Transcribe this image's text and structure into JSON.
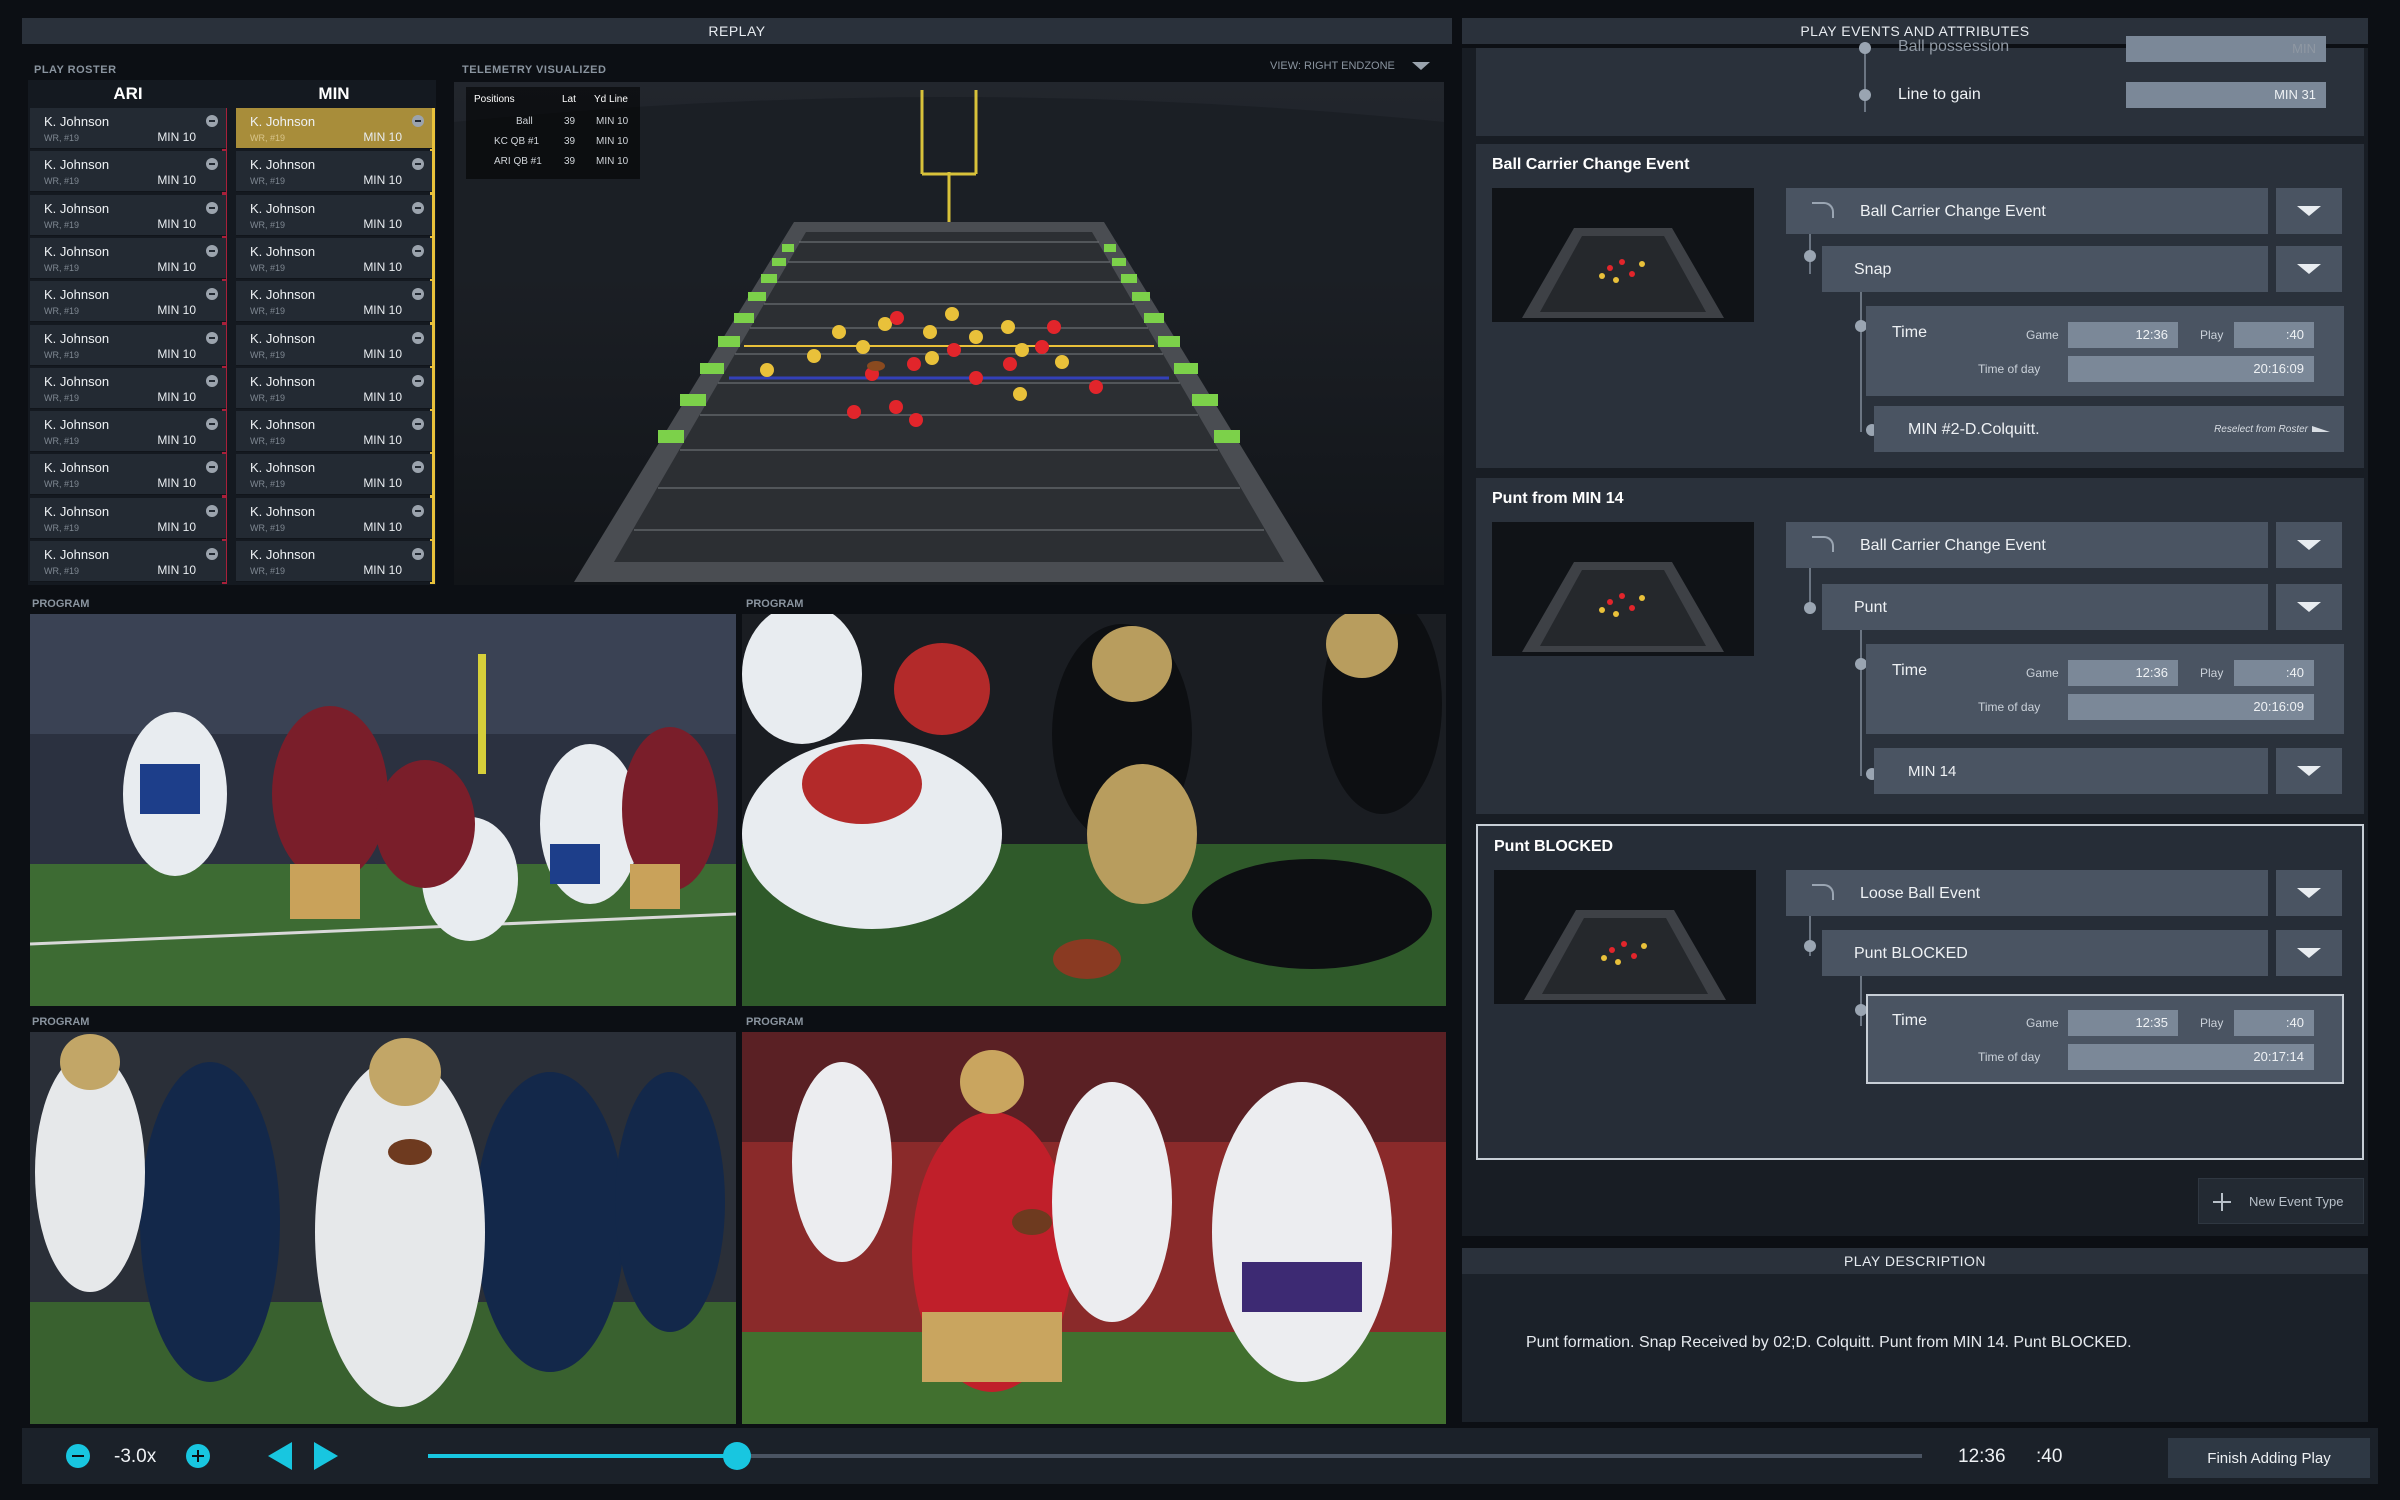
{
  "replay": {
    "title": "REPLAY",
    "roster_label": "PLAY ROSTER",
    "teams": [
      "ARI",
      "MIN"
    ],
    "ari_rows": [
      {
        "name": "K. Johnson",
        "pos": "WR, #19",
        "yd": "MIN 10"
      },
      {
        "name": "K. Johnson",
        "pos": "WR, #19",
        "yd": "MIN 10"
      },
      {
        "name": "K. Johnson",
        "pos": "WR, #19",
        "yd": "MIN 10"
      },
      {
        "name": "K. Johnson",
        "pos": "WR, #19",
        "yd": "MIN 10"
      },
      {
        "name": "K. Johnson",
        "pos": "WR, #19",
        "yd": "MIN 10"
      },
      {
        "name": "K. Johnson",
        "pos": "WR, #19",
        "yd": "MIN 10"
      },
      {
        "name": "K. Johnson",
        "pos": "WR, #19",
        "yd": "MIN 10"
      },
      {
        "name": "K. Johnson",
        "pos": "WR, #19",
        "yd": "MIN 10"
      },
      {
        "name": "K. Johnson",
        "pos": "WR, #19",
        "yd": "MIN 10"
      },
      {
        "name": "K. Johnson",
        "pos": "WR, #19",
        "yd": "MIN 10"
      },
      {
        "name": "K. Johnson",
        "pos": "WR, #19",
        "yd": "MIN 10"
      }
    ],
    "min_rows": [
      {
        "name": "K. Johnson",
        "pos": "WR, #19",
        "yd": "MIN 10"
      },
      {
        "name": "K. Johnson",
        "pos": "WR, #19",
        "yd": "MIN 10"
      },
      {
        "name": "K. Johnson",
        "pos": "WR, #19",
        "yd": "MIN 10"
      },
      {
        "name": "K. Johnson",
        "pos": "WR, #19",
        "yd": "MIN 10"
      },
      {
        "name": "K. Johnson",
        "pos": "WR, #19",
        "yd": "MIN 10"
      },
      {
        "name": "K. Johnson",
        "pos": "WR, #19",
        "yd": "MIN 10"
      },
      {
        "name": "K. Johnson",
        "pos": "WR, #19",
        "yd": "MIN 10"
      },
      {
        "name": "K. Johnson",
        "pos": "WR, #19",
        "yd": "MIN 10"
      },
      {
        "name": "K. Johnson",
        "pos": "WR, #19",
        "yd": "MIN 10"
      },
      {
        "name": "K. Johnson",
        "pos": "WR, #19",
        "yd": "MIN 10"
      },
      {
        "name": "K. Johnson",
        "pos": "WR, #19",
        "yd": "MIN 10"
      }
    ],
    "telemetry_label": "TELEMETRY VISUALIZED",
    "view_label": "VIEW: RIGHT ENDZONE",
    "positions_table": {
      "headers": [
        "Positions",
        "Lat",
        "Yd Line"
      ],
      "rows": [
        [
          "Ball",
          "39",
          "MIN 10"
        ],
        [
          "KC QB #1",
          "39",
          "MIN 10"
        ],
        [
          "ARI QB #1",
          "39",
          "MIN 10"
        ]
      ]
    },
    "program_label": "PROGRAM"
  },
  "events": {
    "title": "PLAY EVENTS AND ATTRIBUTES",
    "top_partial": {
      "label1": "Ball possession",
      "value1": "MIN",
      "label2": "Line to gain",
      "value2": "MIN 31"
    },
    "cards": [
      {
        "title": "Ball Carrier Change Event",
        "event_type": "Ball Carrier Change Event",
        "sub_event": "Snap",
        "time_label": "Time",
        "game_label": "Game",
        "game": "12:36",
        "play_label": "Play",
        "play": ":40",
        "tod_label": "Time of day",
        "tod": "20:16:09",
        "extra": "MIN #2-D.Colquitt.",
        "reselect": "Reselect from Roster"
      },
      {
        "title": "Punt from MIN 14",
        "event_type": "Ball Carrier Change Event",
        "sub_event": "Punt",
        "time_label": "Time",
        "game_label": "Game",
        "game": "12:36",
        "play_label": "Play",
        "play": ":40",
        "tod_label": "Time of day",
        "tod": "20:16:09",
        "extra": "MIN 14"
      },
      {
        "title": "Punt BLOCKED",
        "event_type": "Loose Ball Event",
        "sub_event": "Punt BLOCKED",
        "time_label": "Time",
        "game_label": "Game",
        "game": "12:35",
        "play_label": "Play",
        "play": ":40",
        "tod_label": "Time of day",
        "tod": "20:17:14"
      }
    ],
    "new_event": "New Event Type"
  },
  "description": {
    "title": "PLAY DESCRIPTION",
    "text": "Punt formation. Snap Received by 02;D. Colquitt. Punt from MIN 14. Punt BLOCKED."
  },
  "controls": {
    "speed": "-3.0x",
    "progress": 0.207,
    "game_clock": "12:36",
    "play_clock": ":40",
    "finish": "Finish Adding Play"
  },
  "colors": {
    "accent": "#18c6e0",
    "ari": "#a8203a",
    "min": "#e9c13a",
    "selected": "#a88d3a"
  }
}
